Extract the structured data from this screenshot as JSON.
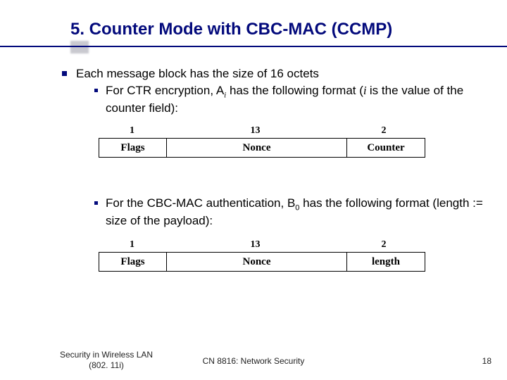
{
  "title": "5. Counter Mode with CBC-MAC (CCMP)",
  "bullets": {
    "l1": "Each message block has the size of 16 octets",
    "l2a_pre": "For CTR encryption, A",
    "l2a_sub": "i",
    "l2a_mid": " has the following format (",
    "l2a_ital": "i ",
    "l2a_post": " is the value of the counter field):",
    "l2b_pre": "For the CBC-MAC authentication, B",
    "l2b_sub": "0",
    "l2b_post": " has the following format (length := size of the payload):"
  },
  "diagram1": {
    "n1": "1",
    "n2": "13",
    "n3": "2",
    "c1": "Flags",
    "c2": "Nonce",
    "c3": "Counter"
  },
  "diagram2": {
    "n1": "1",
    "n2": "13",
    "n3": "2",
    "c1": "Flags",
    "c2": "Nonce",
    "c3": "length"
  },
  "footer": {
    "left_l1": "Security in Wireless LAN",
    "left_l2": "(802. 11i)",
    "mid": "CN 8816: Network Security",
    "right": "18"
  }
}
